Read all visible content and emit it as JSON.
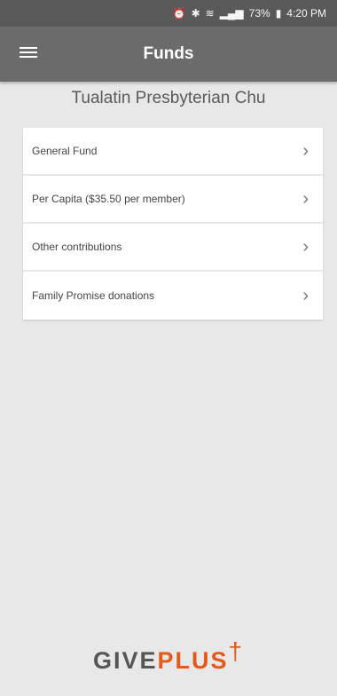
{
  "status_bar": {
    "battery_percent": "73%",
    "time": "4:20 PM",
    "icons": [
      "alarm-icon",
      "bluetooth-icon",
      "wifi-icon",
      "signal-icon",
      "battery-icon"
    ]
  },
  "app_bar": {
    "title": "Funds",
    "menu_icon": "hamburger-menu-icon",
    "background": "#6b6b6b"
  },
  "church": {
    "name": "Tualatin Presbyterian Chu"
  },
  "funds": [
    {
      "label": "General Fund",
      "icon": "chevron-right-icon"
    },
    {
      "label": "Per Capita ($35.50 per member)",
      "icon": "chevron-right-icon"
    },
    {
      "label": "Other contributions",
      "icon": "chevron-right-icon"
    },
    {
      "label": "Family Promise donations",
      "icon": "chevron-right-icon"
    }
  ],
  "footer": {
    "logo_give": "GIVE",
    "logo_plus": "PLUS",
    "logo_mark": "†",
    "accent": "#e35a1b"
  }
}
